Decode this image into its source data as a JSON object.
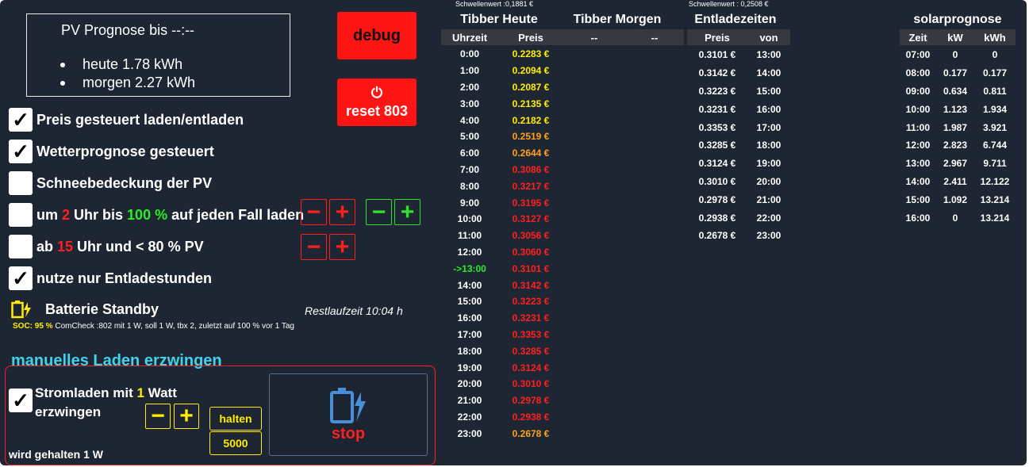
{
  "pv_box": {
    "title": "PV Prognose bis --:--",
    "items": [
      "heute 1.78 kWh",
      "morgen 2.27 kWh"
    ]
  },
  "buttons": {
    "debug": "debug",
    "reset": "reset 803",
    "power_icon": "⏻"
  },
  "options": [
    {
      "checked": true,
      "label": "Preis gesteuert laden/entladen"
    },
    {
      "checked": true,
      "label": "Wetterprognose gesteuert"
    },
    {
      "checked": false,
      "label": "Schneebedeckung der PV"
    },
    {
      "checked": false,
      "prefix": "um ",
      "hour": "2",
      "mid": " Uhr bis ",
      "pct": "100 %",
      "suffix": " auf jeden Fall laden"
    },
    {
      "checked": false,
      "prefix": "ab ",
      "hour": "15",
      "suffix": " Uhr und < 80 % PV"
    },
    {
      "checked": true,
      "label": "nutze nur Entladestunden"
    }
  ],
  "stepper": {
    "minus": "−",
    "plus": "+"
  },
  "battery": {
    "label": "Batterie Standby",
    "restlaufzeit": "Restlaufzeit 10:04 h",
    "soc_label": "SOC: 95 %",
    "comcheck": " ComCheck :802 mit 1 W, soll 1 W, tbx 2, zuletzt auf 100 % vor 1 Tag"
  },
  "manual": {
    "title": "manuelles Laden erzwingen",
    "checked": true,
    "label_a": "Stromladen mit ",
    "watt": "1",
    "label_b": " Watt",
    "label_c": "erzwingen",
    "halten": "halten",
    "value": "5000",
    "status": "wird gehalten 1 W",
    "stop": "stop"
  },
  "tibber_heute": {
    "threshold": "Schwellenwert :0,1881 €",
    "title": "Tibber Heute",
    "col_hour": "Uhrzeit",
    "col_price": "Preis",
    "rows": [
      {
        "hour": "0:00",
        "price": "0.2283 €",
        "color": "yellow"
      },
      {
        "hour": "1:00",
        "price": "0.2094 €",
        "color": "yellow"
      },
      {
        "hour": "2:00",
        "price": "0.2087 €",
        "color": "yellow"
      },
      {
        "hour": "3:00",
        "price": "0.2135 €",
        "color": "yellow"
      },
      {
        "hour": "4:00",
        "price": "0.2182 €",
        "color": "yellow"
      },
      {
        "hour": "5:00",
        "price": "0.2519 €",
        "color": "orange"
      },
      {
        "hour": "6:00",
        "price": "0.2644 €",
        "color": "orange"
      },
      {
        "hour": "7:00",
        "price": "0.3086 €",
        "color": "red"
      },
      {
        "hour": "8:00",
        "price": "0.3217 €",
        "color": "red"
      },
      {
        "hour": "9:00",
        "price": "0.3195 €",
        "color": "red"
      },
      {
        "hour": "10:00",
        "price": "0.3127 €",
        "color": "red"
      },
      {
        "hour": "11:00",
        "price": "0.3056 €",
        "color": "red"
      },
      {
        "hour": "12:00",
        "price": "0.3060 €",
        "color": "red"
      },
      {
        "hour": "->13:00",
        "price": "0.3101 €",
        "color": "red",
        "current": true
      },
      {
        "hour": "14:00",
        "price": "0.3142 €",
        "color": "red"
      },
      {
        "hour": "15:00",
        "price": "0.3223 €",
        "color": "red"
      },
      {
        "hour": "16:00",
        "price": "0.3231 €",
        "color": "red"
      },
      {
        "hour": "17:00",
        "price": "0.3353 €",
        "color": "red"
      },
      {
        "hour": "18:00",
        "price": "0.3285 €",
        "color": "red"
      },
      {
        "hour": "19:00",
        "price": "0.3124 €",
        "color": "red"
      },
      {
        "hour": "20:00",
        "price": "0.3010 €",
        "color": "red"
      },
      {
        "hour": "21:00",
        "price": "0.2978 €",
        "color": "red"
      },
      {
        "hour": "22:00",
        "price": "0.2938 €",
        "color": "red"
      },
      {
        "hour": "23:00",
        "price": "0.2678 €",
        "color": "orange"
      }
    ]
  },
  "tibber_morgen": {
    "title": "Tibber Morgen",
    "col_a": "--",
    "col_b": "--"
  },
  "entladezeiten": {
    "threshold": "Schwellenwert : 0,2508 €",
    "title": "Entladezeiten",
    "col_price": "Preis",
    "col_from": "von",
    "rows": [
      {
        "price": "0.3101 €",
        "from": "13:00"
      },
      {
        "price": "0.3142 €",
        "from": "14:00"
      },
      {
        "price": "0.3223 €",
        "from": "15:00"
      },
      {
        "price": "0.3231 €",
        "from": "16:00"
      },
      {
        "price": "0.3353 €",
        "from": "17:00"
      },
      {
        "price": "0.3285 €",
        "from": "18:00"
      },
      {
        "price": "0.3124 €",
        "from": "19:00"
      },
      {
        "price": "0.3010 €",
        "from": "20:00"
      },
      {
        "price": "0.2978 €",
        "from": "21:00"
      },
      {
        "price": "0.2938 €",
        "from": "22:00"
      },
      {
        "price": "0.2678 €",
        "from": "23:00"
      }
    ]
  },
  "solarprognose": {
    "title": "solarprognose",
    "col_time": "Zeit",
    "col_kw": "kW",
    "col_kwh": "kWh",
    "rows": [
      {
        "time": "07:00",
        "kw": "0",
        "kwh": "0"
      },
      {
        "time": "08:00",
        "kw": "0.177",
        "kwh": "0.177"
      },
      {
        "time": "09:00",
        "kw": "0.634",
        "kwh": "0.811"
      },
      {
        "time": "10:00",
        "kw": "1.123",
        "kwh": "1.934"
      },
      {
        "time": "11:00",
        "kw": "1.987",
        "kwh": "3.921"
      },
      {
        "time": "12:00",
        "kw": "2.823",
        "kwh": "6.744"
      },
      {
        "time": "13:00",
        "kw": "2.967",
        "kwh": "9.711"
      },
      {
        "time": "14:00",
        "kw": "2.411",
        "kwh": "12.122"
      },
      {
        "time": "15:00",
        "kw": "1.092",
        "kwh": "13.214"
      },
      {
        "time": "16:00",
        "kw": "0",
        "kwh": "13.214"
      }
    ]
  },
  "colors": {
    "background": "#1f2633",
    "red": "#ff2020",
    "yellow": "#ffee00",
    "orange": "#ffa21a",
    "green": "#28ee28",
    "cyan": "#3fd4ec"
  },
  "icons": {
    "check": "✓",
    "battery_icon": "battery-charging-icon"
  }
}
